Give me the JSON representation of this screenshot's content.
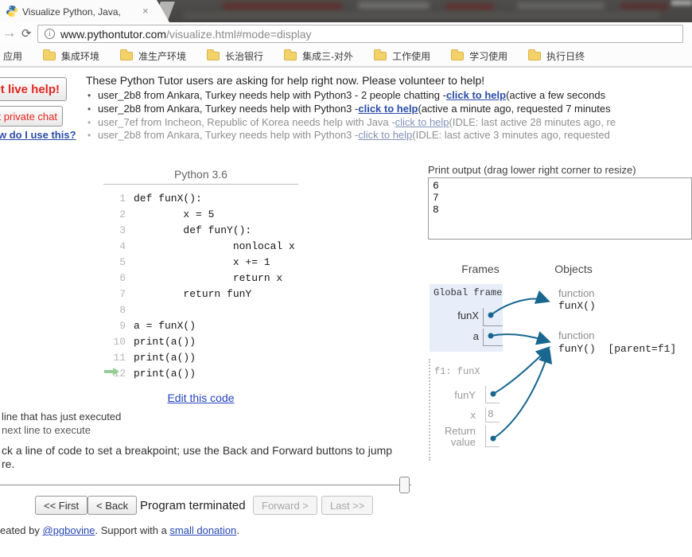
{
  "browser": {
    "tab_title": "Visualize Python, Java,",
    "close_glyph": "×",
    "forward_glyph": "→",
    "reload_glyph": "⟳",
    "info_glyph": "i",
    "url_host": "www.pythontutor.com",
    "url_path": "/visualize.html#mode=display",
    "bookmarks": [
      "应用",
      "集成环境",
      "准生产环境",
      "长治银行",
      "集成三-对外",
      "工作使用",
      "学习使用",
      "执行日终"
    ]
  },
  "help_banner": {
    "bullet_glyph": "•",
    "heading": "These Python Tutor users are asking for help right now. Please volunteer to help!",
    "requests": [
      {
        "pre": "user_2b8 from Ankara, Turkey needs help with Python3 - 2 people chatting - ",
        "link": "click to help",
        "post": " (active a few seconds"
      },
      {
        "pre": "user_2b8 from Ankara, Turkey needs help with Python3 - ",
        "link": "click to help",
        "post": " (active a minute ago, requested 7 minutes"
      },
      {
        "pre": "user_7ef from Incheon, Republic of Korea needs help with Java - ",
        "link": "click to help",
        "post": " (IDLE: last active 28 minutes ago, re"
      },
      {
        "pre": "user_2b8 from Ankara, Turkey needs help with Python3 - ",
        "link": "click to help",
        "post": " (IDLE: last active 3 minutes ago, requested"
      }
    ]
  },
  "sidebar": {
    "live_help_label": "et live help!",
    "private_chat_label": "art private chat",
    "howto_label": "w do I use this?"
  },
  "code_panel": {
    "lang_label": "Python 3.6",
    "edit_link": "Edit this code",
    "current_line": 12,
    "lines": [
      {
        "n": "1",
        "c": "def funX():"
      },
      {
        "n": "2",
        "c": "        x = 5"
      },
      {
        "n": "3",
        "c": "        def funY():"
      },
      {
        "n": "4",
        "c": "                nonlocal x"
      },
      {
        "n": "5",
        "c": "                x += 1"
      },
      {
        "n": "6",
        "c": "                return x"
      },
      {
        "n": "7",
        "c": "        return funY"
      },
      {
        "n": "8",
        "c": ""
      },
      {
        "n": "9",
        "c": "a = funX()"
      },
      {
        "n": "10",
        "c": "print(a())"
      },
      {
        "n": "11",
        "c": "print(a())"
      },
      {
        "n": "12",
        "c": "print(a())"
      }
    ]
  },
  "legend": {
    "just_executed": "line that has just executed",
    "next_line": "next line to execute",
    "hint_line1": "ck a line of code to set a breakpoint; use the Back and Forward buttons to jump",
    "hint_line2": "re."
  },
  "controls": {
    "first": "<< First",
    "back": "< Back",
    "status": "Program terminated",
    "forward": "Forward >",
    "last": "Last >>"
  },
  "footer": {
    "prefix": "eated by ",
    "author_link": "@pgbovine",
    "middle": ". Support with a ",
    "donation_link": "small donation",
    "end": "."
  },
  "output_panel": {
    "label": "Print output (drag lower right corner to resize)",
    "content": "6\n7\n8"
  },
  "viz": {
    "frames_header": "Frames",
    "objects_header": "Objects",
    "global_frame": {
      "title": "Global frame",
      "var1": "funX",
      "var2": "a"
    },
    "f1_frame": {
      "title": "f1: funX",
      "var1": "funY",
      "var2": "x",
      "var2_value": "8",
      "var3": "Return value"
    },
    "objects": [
      {
        "kind": "function",
        "repr": "funX()"
      },
      {
        "kind": "function",
        "repr": "funY()  [parent=f1]"
      }
    ]
  },
  "colors": {
    "pointer_arrow": "#19678f",
    "exec_arrow_green": "#97cb97",
    "link_blue": "#2646b4",
    "help_red": "#e5261f",
    "frame_bg": "#e7eefa"
  }
}
